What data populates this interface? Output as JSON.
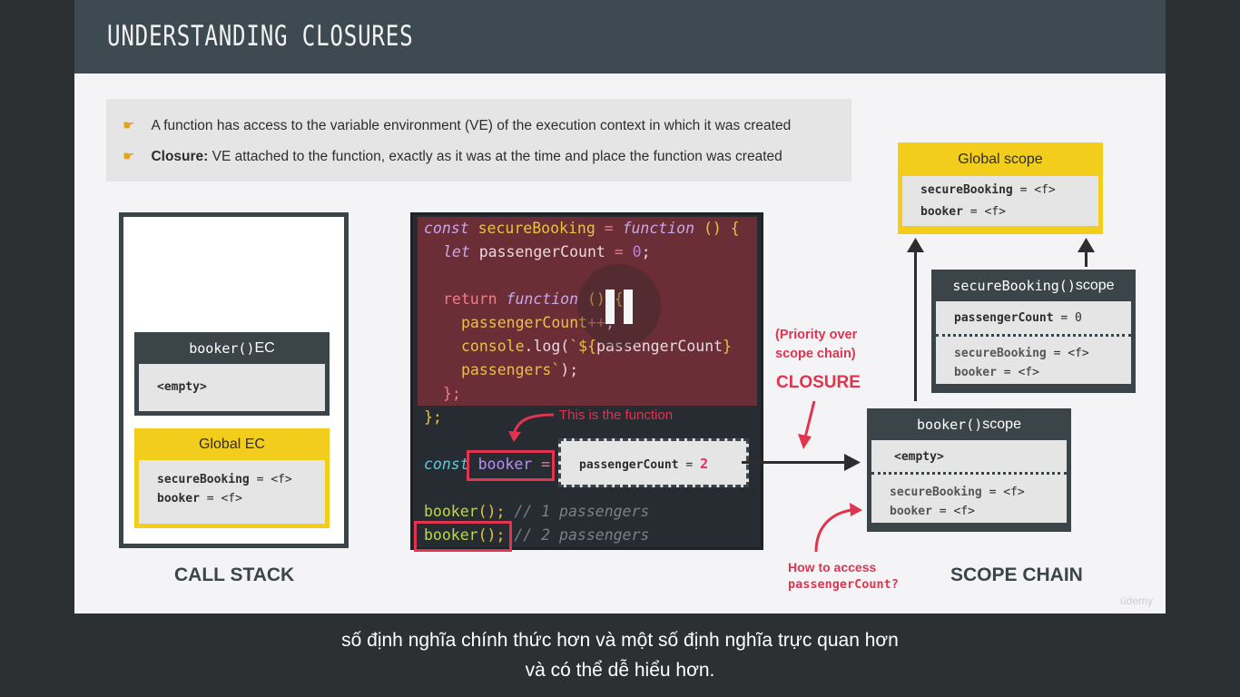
{
  "slide": {
    "title": "UNDERSTANDING CLOSURES",
    "bullets": [
      {
        "icon": "pointing-hand-icon",
        "prefix": "",
        "text": "A function has access to the variable environment (VE) of the execution context in which it was created"
      },
      {
        "icon": "pointing-hand-icon",
        "prefix": "Closure:",
        "text": " VE attached to the function, exactly as it was at the time and place the function was created"
      }
    ],
    "call_stack": {
      "label": "CALL STACK",
      "booker_ec": {
        "title_code": "booker()",
        "title_text": " EC",
        "body": "<empty>"
      },
      "global_ec": {
        "title": "Global EC",
        "vars": [
          {
            "name": "secureBooking",
            "val": " = <f>"
          },
          {
            "name": "booker",
            "val": " = <f>"
          }
        ]
      }
    },
    "code": {
      "line1": {
        "a": "const ",
        "b": "secureBooking",
        "c": " = ",
        "d": "function",
        "e": " () {"
      },
      "line2": {
        "a": "let ",
        "b": "passengerCount",
        "c": " = ",
        "d": "0",
        "e": ";"
      },
      "line3": {
        "a": "return ",
        "b": "function",
        "c": " () {"
      },
      "line4": {
        "a": "passengerCount",
        "b": "++",
        "c": ";"
      },
      "line5": {
        "a": "console",
        "b": ".log(",
        "c": "`${",
        "d": "passengerCount",
        "e": "}"
      },
      "line6": {
        "a": "passengers",
        "b": "`",
        "c": ");"
      },
      "line7": {
        "a": "};"
      },
      "line8": {
        "a": "};"
      },
      "line9": {
        "a": "const ",
        "b": "booker",
        "c": " ="
      },
      "line10": {
        "a": "booker",
        "b": "();",
        "c": " // 1 passengers"
      },
      "line11": {
        "a": "booker",
        "b": "();",
        "c": " // 2 passengers"
      },
      "annotation": "This is the function",
      "closure_var": {
        "name": "passengerCount",
        "eq": " = ",
        "val": "2"
      }
    },
    "closure_note": {
      "line1": "(Priority over",
      "line2": "scope chain)",
      "title": "CLOSURE"
    },
    "scope_chain": {
      "label": "SCOPE CHAIN",
      "global_scope": {
        "title": "Global scope",
        "vars": [
          {
            "name": "secureBooking",
            "val": " = <f>"
          },
          {
            "name": "booker",
            "val": " = <f>"
          }
        ]
      },
      "secure_scope": {
        "title_code": "secureBooking()",
        "title_text": " scope",
        "own": {
          "name": "passengerCount",
          "val": " = 0"
        },
        "vars": [
          {
            "name": "secureBooking",
            "val": " = <f>"
          },
          {
            "name": "booker",
            "val": " = <f>"
          }
        ]
      },
      "booker_scope": {
        "title_code": "booker()",
        "title_text": " scope",
        "own": "<empty>",
        "vars": [
          {
            "name": "secureBooking",
            "val": " = <f>"
          },
          {
            "name": "booker",
            "val": " = <f>"
          }
        ]
      },
      "question": {
        "line1": "How to access",
        "line2": "passengerCount?"
      }
    },
    "watermark": "ûdemy"
  },
  "subtitles": [
    "số định nghĩa chính thức hơn và một số định nghĩa trực quan hơn",
    "và có thể dễ hiểu hơn."
  ],
  "colors": {
    "accent_yellow": "#f2cd1c",
    "accent_red": "#e0344f",
    "header": "#3e4a51"
  }
}
